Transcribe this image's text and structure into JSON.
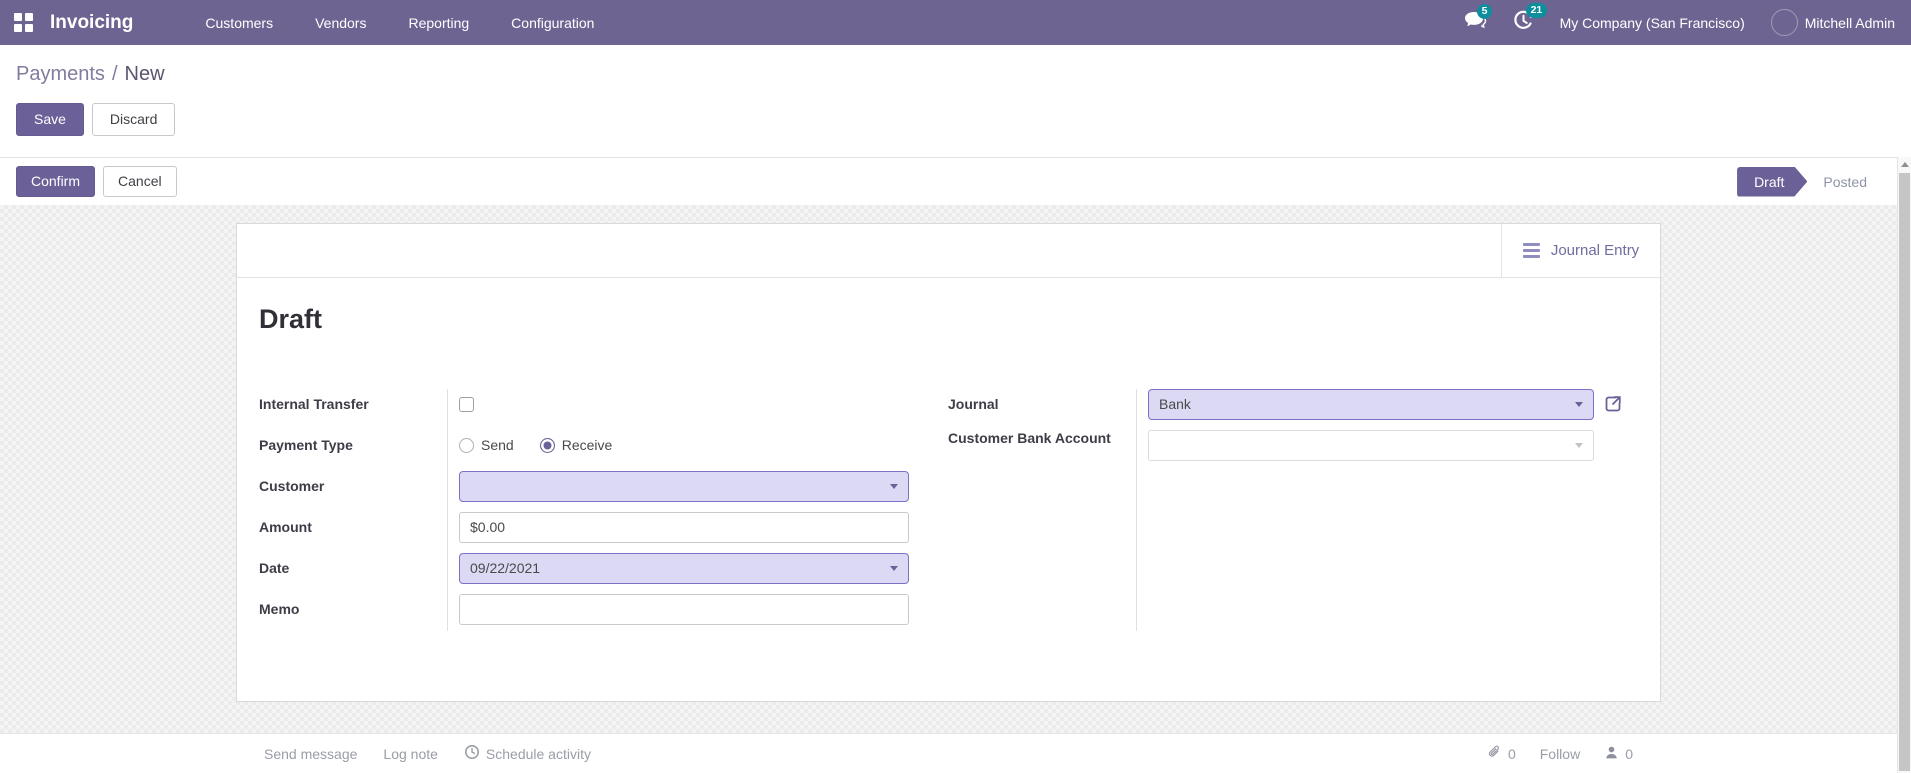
{
  "nav": {
    "app_name": "Invoicing",
    "menus": [
      "Customers",
      "Vendors",
      "Reporting",
      "Configuration"
    ],
    "messages_badge": "5",
    "activities_badge": "21",
    "company": "My Company (San Francisco)",
    "user": "Mitchell Admin"
  },
  "breadcrumb": {
    "parent": "Payments",
    "separator": "/",
    "current": "New"
  },
  "control_panel": {
    "save": "Save",
    "discard": "Discard"
  },
  "status_actions": {
    "confirm": "Confirm",
    "cancel": "Cancel"
  },
  "statusbar": {
    "draft": "Draft",
    "posted": "Posted",
    "active_state": "Draft"
  },
  "sheet": {
    "journal_entry_button": "Journal Entry",
    "state_title": "Draft",
    "left_fields": {
      "internal_transfer": "Internal Transfer",
      "internal_transfer_checked": false,
      "payment_type": "Payment Type",
      "send": "Send",
      "receive": "Receive",
      "payment_type_selected": "Receive",
      "customer": "Customer",
      "amount": "Amount",
      "amount_value": "$0.00",
      "date": "Date",
      "date_value": "09/22/2021",
      "memo": "Memo"
    },
    "right_fields": {
      "journal": "Journal",
      "journal_value": "Bank",
      "customer_bank_account": "Customer Bank Account"
    }
  },
  "chatter": {
    "send_message": "Send message",
    "log_note": "Log note",
    "schedule_activity": "Schedule activity",
    "attachments_count": "0",
    "follow": "Follow",
    "followers_count": "0"
  },
  "colors": {
    "topbar_purple": "#6e6492",
    "primary_purple": "#6b6198",
    "lavender_field_bg": "#dbd9f4",
    "lavender_field_border": "#7b72c7",
    "badge_teal": "#0c8e9c"
  }
}
